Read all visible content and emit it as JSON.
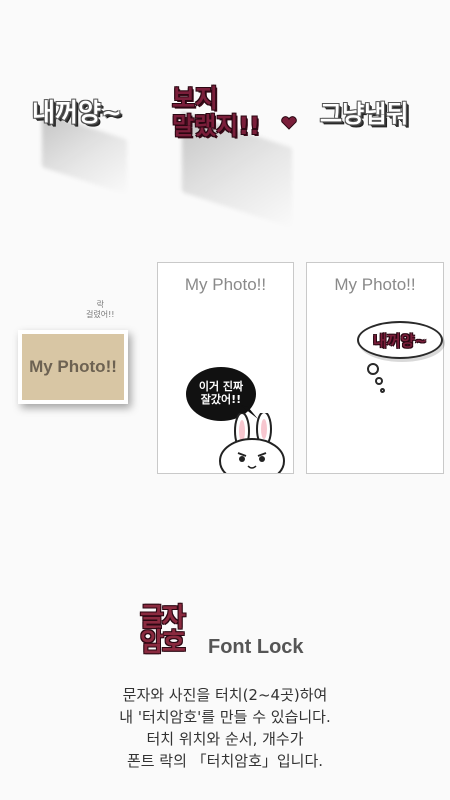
{
  "stickers": {
    "s1": "내꺼양~",
    "s2_line1": "보지",
    "s2_line2": "말랬지!!",
    "s3": "그냥냅둬"
  },
  "card1": {
    "title": "My Photo!!",
    "speech_line1": "이거 진짜",
    "speech_line2": "잘갔어!!"
  },
  "card2": {
    "title": "My Photo!!",
    "thought": "내꺼양~"
  },
  "small_photo": {
    "label": "My Photo!!",
    "tag_line1": "락",
    "tag_line2": "걸렸어!!"
  },
  "brand": {
    "logo_line1": "글자",
    "logo_line2": "암호",
    "name": "Font Lock"
  },
  "description": {
    "line1": "문자와 사진을 터치(2~4곳)하여",
    "line2": "내 '터치암호'를 만들 수 있습니다.",
    "line3": "터치 위치와 순서, 개수가",
    "line4": "폰트 락의 「터치암호」입니다."
  },
  "colors": {
    "background": "#fafafa",
    "accent": "#7a1e3a",
    "photo": "#d8c6a4"
  }
}
